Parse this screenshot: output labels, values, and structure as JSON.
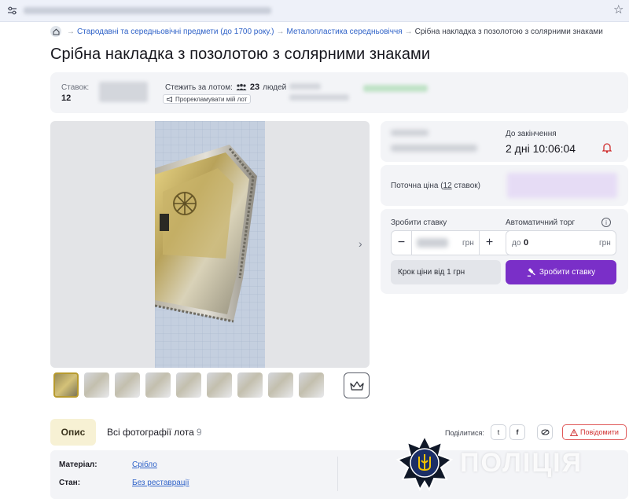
{
  "browser": {
    "star_icon": "star-outline-icon"
  },
  "breadcrumb": {
    "items": [
      "Стародавні та середньовічні предмети (до 1700 року.)",
      "Металопластика середньовіччя",
      "Срібна накладка з позолотою з солярними знаками"
    ],
    "separator": "→"
  },
  "page_title": "Срібна накладка з позолотою з солярними знаками",
  "stats": {
    "bids_label": "Ставок:",
    "bids_value": "12",
    "watch_label": "Стежить за лотом:",
    "watch_count": "23",
    "watch_unit": "людей",
    "promote_label": "Прорекламувати мій лот"
  },
  "pricing": {
    "until_end_label": "До закінчення",
    "countdown": "2 дні 10:06:04",
    "current_price_label": "Поточна ціна",
    "bids_count_link": "12",
    "bids_count_suffix": "ставок",
    "place_bid_label": "Зробити ставку",
    "auto_bid_label": "Автоматичний торг",
    "currency": "грн",
    "auto_prefix": "до",
    "auto_value": "0",
    "step_note": "Крок ціни від 1 грн",
    "bid_button": "Зробити ставку",
    "minus": "−",
    "plus": "+",
    "info": "i"
  },
  "tabs": {
    "description": "Опис",
    "all_photos": "Всі фотографії лота",
    "photo_count": "9"
  },
  "share": {
    "label": "Поділитися:",
    "twitter": "t",
    "facebook": "f",
    "report": "Повідомити"
  },
  "properties": [
    {
      "label": "Матеріал:",
      "value": "Срібло"
    },
    {
      "label": "Стан:",
      "value": "Без реставрації"
    }
  ],
  "watermark": {
    "text": "ПОЛІЦІЯ"
  },
  "colors": {
    "accent_purple": "#7a2fc8",
    "link_blue": "#2f62c8",
    "report_red": "#d02f2f",
    "panel_gray": "#f3f4f7"
  }
}
